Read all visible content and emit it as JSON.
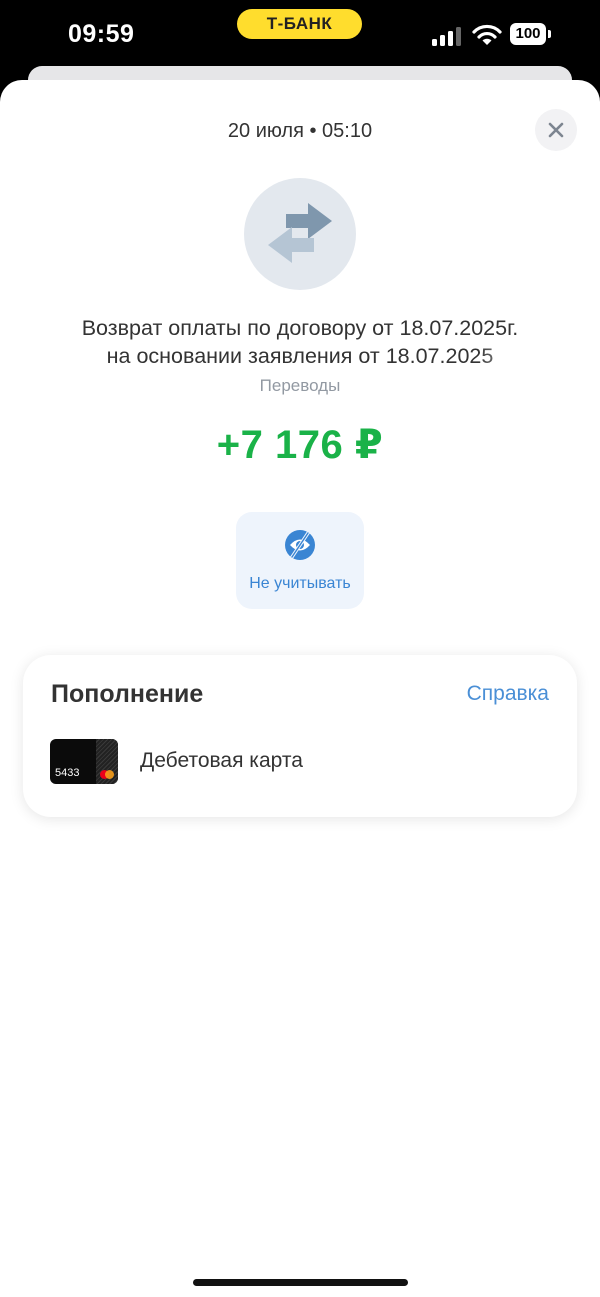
{
  "status_bar": {
    "time": "09:59",
    "brand": "Т-БАНК",
    "battery": "100",
    "icons": [
      "cellular-signal-icon",
      "wifi-icon",
      "battery-icon"
    ]
  },
  "header": {
    "date_time": "20 июля • 05:10",
    "close_icon": "close-icon"
  },
  "operation": {
    "icon": "transfer-arrows-icon",
    "description_line1": "Возврат оплаты по договору от 18.07.2025г.",
    "description_line2": "на основании заявления от 18.07.2025",
    "category": "Переводы",
    "amount": "+7 176 ₽",
    "amount_color": "#1ab248"
  },
  "actions": {
    "ignore_label": "Не учитывать",
    "ignore_icon": "eye-off-icon"
  },
  "funding": {
    "title": "Пополнение",
    "help": "Справка",
    "card_last4": "5433",
    "card_name": "Дебетовая карта",
    "accent_color": "#4a8fd6"
  }
}
